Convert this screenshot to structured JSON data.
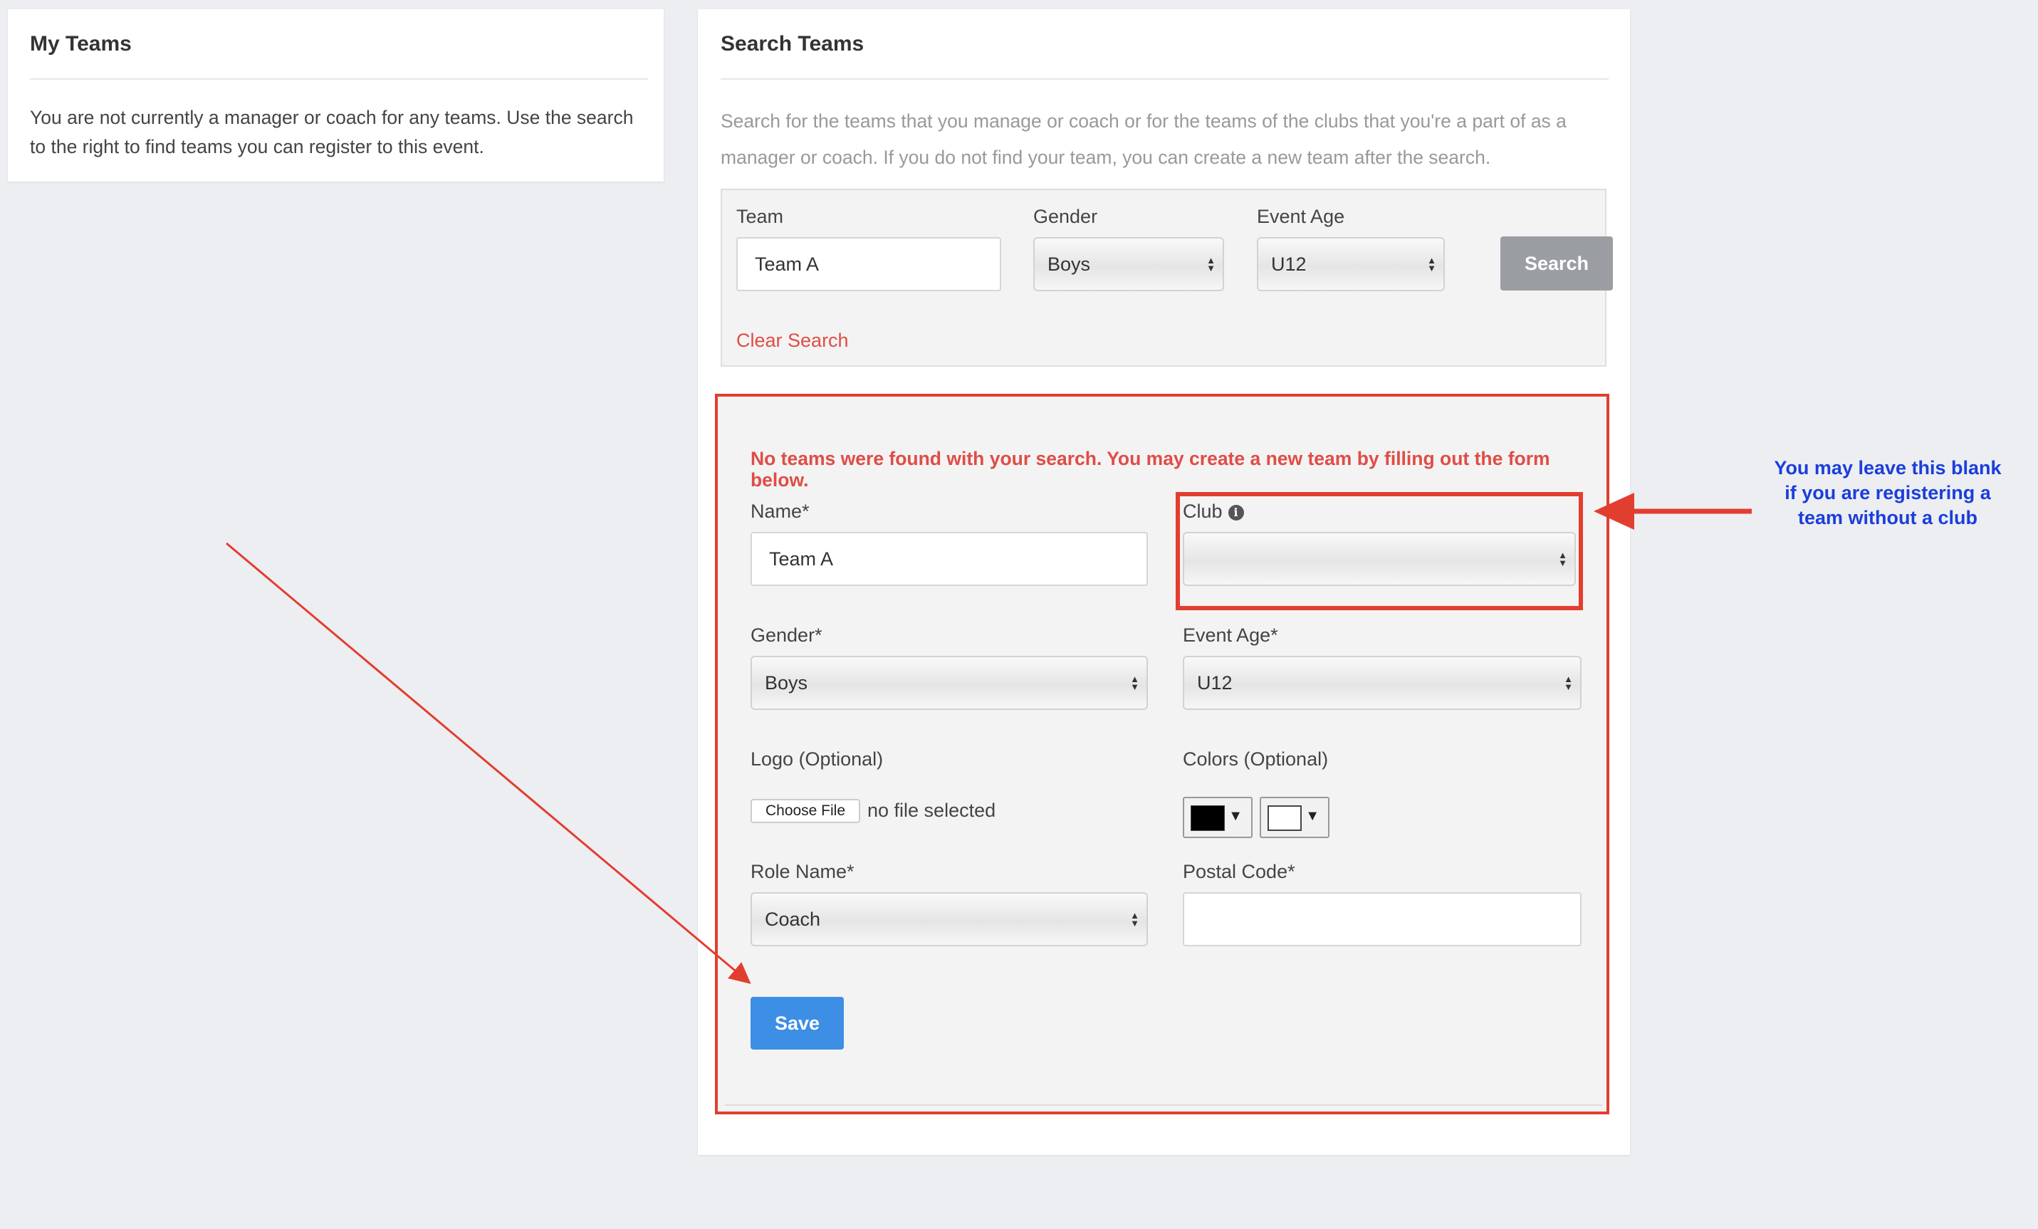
{
  "my_teams": {
    "title": "My Teams",
    "message": "You are not currently a manager or coach for any teams. Use the search to the right to find teams you can register to this event."
  },
  "search_teams": {
    "title": "Search Teams",
    "instructions": "Search for the teams that you manage or coach or for the teams of the clubs that you're a part of as a manager or coach. If you do not find your team, you can create a new team after the search.",
    "filters": {
      "team_label": "Team",
      "team_value": "Team A",
      "gender_label": "Gender",
      "gender_value": "Boys",
      "age_label": "Event Age",
      "age_value": "U12",
      "search_button": "Search",
      "clear_link": "Clear Search"
    }
  },
  "create_form": {
    "message": "No teams were found with your search. You may create a new team by filling out the form below.",
    "name_label": "Name*",
    "name_value": "Team A",
    "club_label": "Club",
    "club_value": "",
    "gender_label": "Gender*",
    "gender_value": "Boys",
    "age_label": "Event Age*",
    "age_value": "U12",
    "logo_label": "Logo (Optional)",
    "choose_file": "Choose File",
    "no_file": "no file selected",
    "colors_label": "Colors (Optional)",
    "color_primary": "#000000",
    "color_secondary": "#ffffff",
    "role_label": "Role Name*",
    "role_value": "Coach",
    "postal_label": "Postal Code*",
    "postal_value": "",
    "save_button": "Save"
  },
  "annotation": {
    "text": "You may leave this blank if you are registering a team without a club",
    "color": "#1a3edb",
    "arrow_color": "#e23e2f"
  }
}
